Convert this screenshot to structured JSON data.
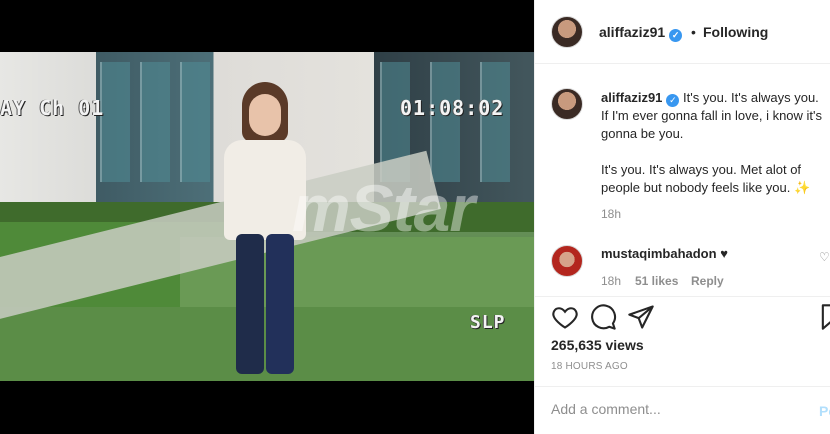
{
  "media": {
    "vhs_left": "AY   Ch 01",
    "vhs_time": "01:08:02",
    "vhs_mode": "SLP",
    "watermark": "mStar"
  },
  "header": {
    "username": "aliffaziz91",
    "separator": "•",
    "follow_label": "Following"
  },
  "caption": {
    "username": "aliffaziz91",
    "text_line1": "It's you. It's always you. If I'm ever gonna fall in love, i know it's gonna be you.",
    "text_line2": "It's you. It's always you. Met alot of people but nobody feels like you. ✨",
    "time": "18h"
  },
  "comment": {
    "username": "mustaqimbahadon",
    "text": "♥",
    "time": "18h",
    "likes": "51 likes",
    "reply_label": "Reply"
  },
  "actions": {
    "views": "265,635 views",
    "posted": "18 HOURS AGO"
  },
  "add_comment": {
    "placeholder": "Add a comment...",
    "post_label": "Po"
  },
  "colors": {
    "verified": "#3897f0",
    "secondary_text": "#8e8e8e",
    "post_button": "#b2dffc"
  }
}
